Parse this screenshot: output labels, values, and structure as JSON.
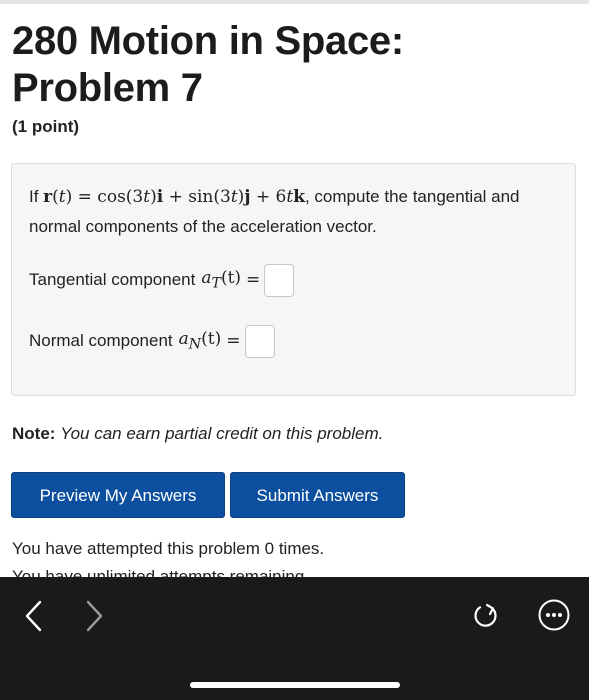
{
  "problem": {
    "title_line1": "280 Motion in Space:",
    "title_line2": "Problem 7",
    "points": "(1 point)"
  },
  "statement": {
    "prefix": "If ",
    "formula": "r(t) = cos(3t)i + sin(3t)j + 6tk",
    "suffix": ", compute the tangential and normal components of the acceleration vector."
  },
  "answers": [
    {
      "label": "Tangential component",
      "symbol": "a",
      "subscript": "T",
      "arg": "(t)",
      "value": ""
    },
    {
      "label": "Normal component",
      "symbol": "a",
      "subscript": "N",
      "arg": "(t)",
      "value": ""
    }
  ],
  "note": {
    "label": "Note:",
    "text": "You can earn partial credit on this problem."
  },
  "buttons": {
    "preview": "Preview My Answers",
    "submit": "Submit Answers"
  },
  "status": {
    "attempts": "You have attempted this problem 0 times.",
    "remaining": "You have unlimited attempts remaining."
  },
  "colors": {
    "button_bg": "#0d4f9f",
    "toolbar_bg": "#1a1a1a",
    "problem_box_bg": "#f6f6f6"
  },
  "toolbar_icons": [
    "back-icon",
    "forward-icon",
    "reload-icon",
    "more-icon"
  ]
}
